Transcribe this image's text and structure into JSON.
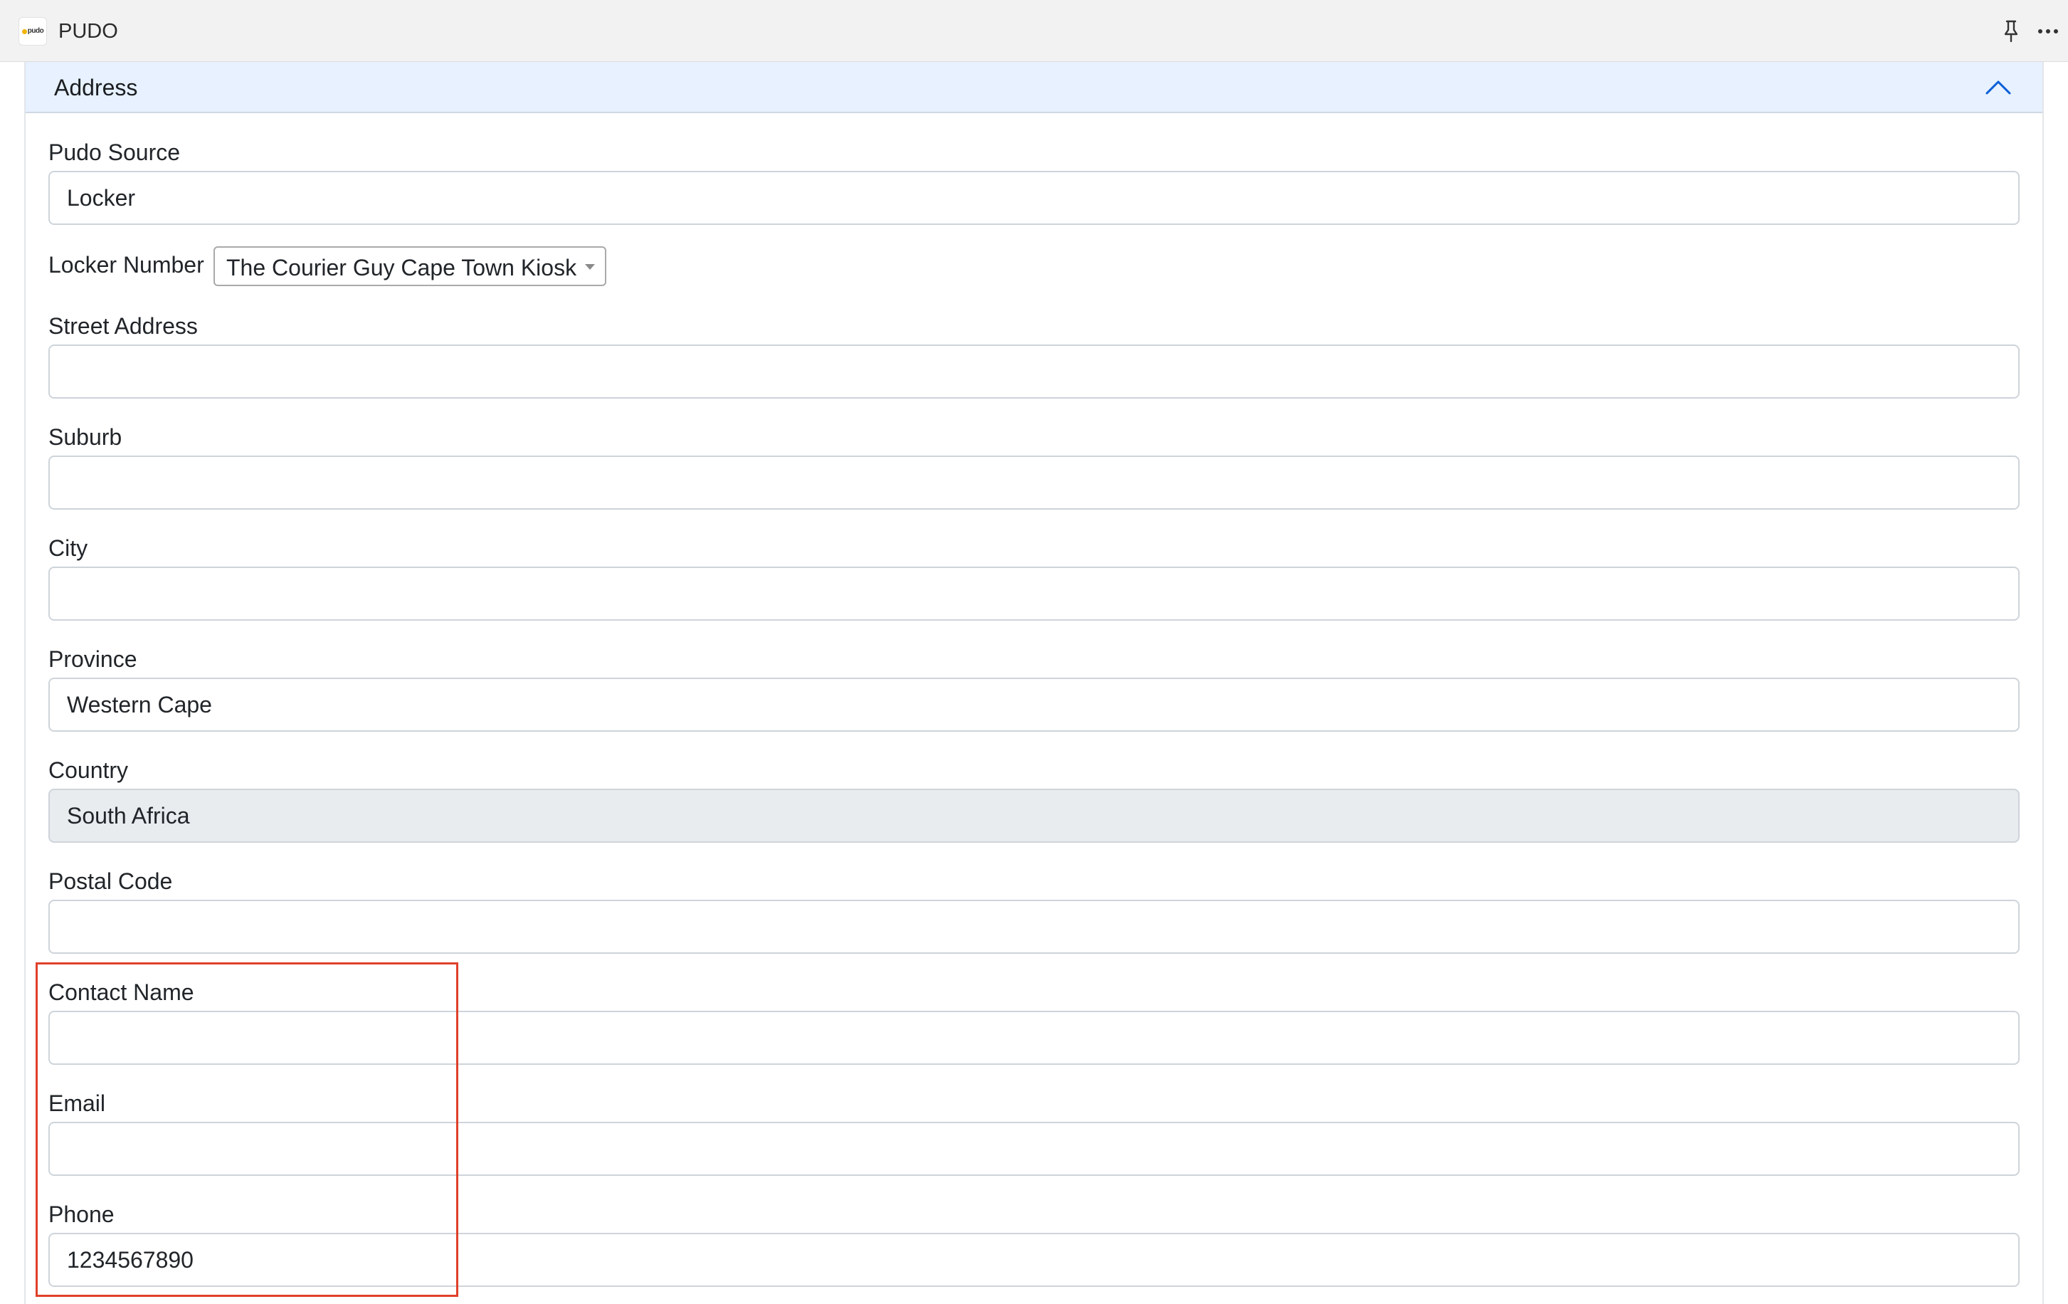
{
  "window": {
    "title": "PUDO",
    "logo_text": "pudo"
  },
  "accordion": {
    "title": "Address",
    "expanded": true
  },
  "form": {
    "pudo_source": {
      "label": "Pudo Source",
      "value": "Locker"
    },
    "locker_number": {
      "label": "Locker Number",
      "selected": "The Courier Guy Cape Town Kiosk"
    },
    "street_address": {
      "label": "Street Address",
      "value": ""
    },
    "suburb": {
      "label": "Suburb",
      "value": ""
    },
    "city": {
      "label": "City",
      "value": ""
    },
    "province": {
      "label": "Province",
      "value": "Western Cape"
    },
    "country": {
      "label": "Country",
      "value": "South Africa",
      "disabled": true
    },
    "postal_code": {
      "label": "Postal Code",
      "value": ""
    },
    "contact_name": {
      "label": "Contact Name",
      "value": ""
    },
    "email": {
      "label": "Email",
      "value": ""
    },
    "phone": {
      "label": "Phone",
      "value": "1234567890"
    }
  },
  "icons": {
    "pin": "pin-icon",
    "more": "more-icon",
    "chevron": "chevron-up-icon",
    "caret": "caret-down-icon"
  },
  "colors": {
    "header_bg": "#e7f1ff",
    "highlight": "#e0402a",
    "disabled_bg": "#e9ecef"
  }
}
